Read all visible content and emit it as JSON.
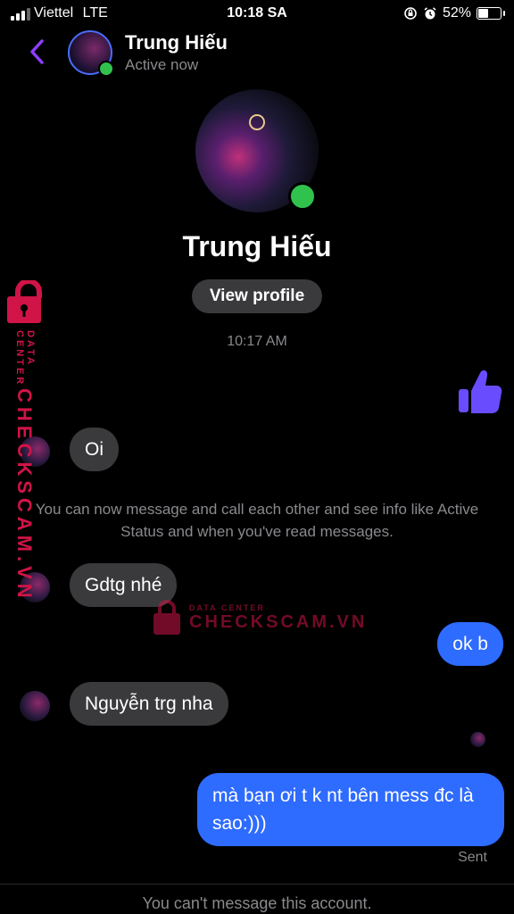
{
  "status_bar": {
    "carrier": "Viettel",
    "network": "LTE",
    "time": "10:18 SA",
    "battery": "52%",
    "battery_level": 0.52
  },
  "header": {
    "name": "Trung Hiếu",
    "status": "Active now"
  },
  "profile": {
    "name": "Trung Hiếu",
    "view_profile_label": "View profile",
    "timestamp": "10:17 AM"
  },
  "messages": {
    "m1": "Oi",
    "notice": "You can now message and call each other and see info like Active Status and when you've read messages.",
    "m2": "Gdtg nhé",
    "m3": "ok b",
    "m4": "Nguyễn trg nha",
    "m5": "mà bạn ơi t k nt bên mess đc là sao:)))",
    "sent_label": "Sent"
  },
  "footer": {
    "text": "You can't message this account."
  },
  "watermark": {
    "small": "DATA CENTER",
    "big": "CHECKSCAM.VN"
  },
  "colors": {
    "accent_blue": "#2e6bff",
    "back_purple": "#8f3fff",
    "online_green": "#31c24d",
    "watermark_red": "#d01447"
  }
}
